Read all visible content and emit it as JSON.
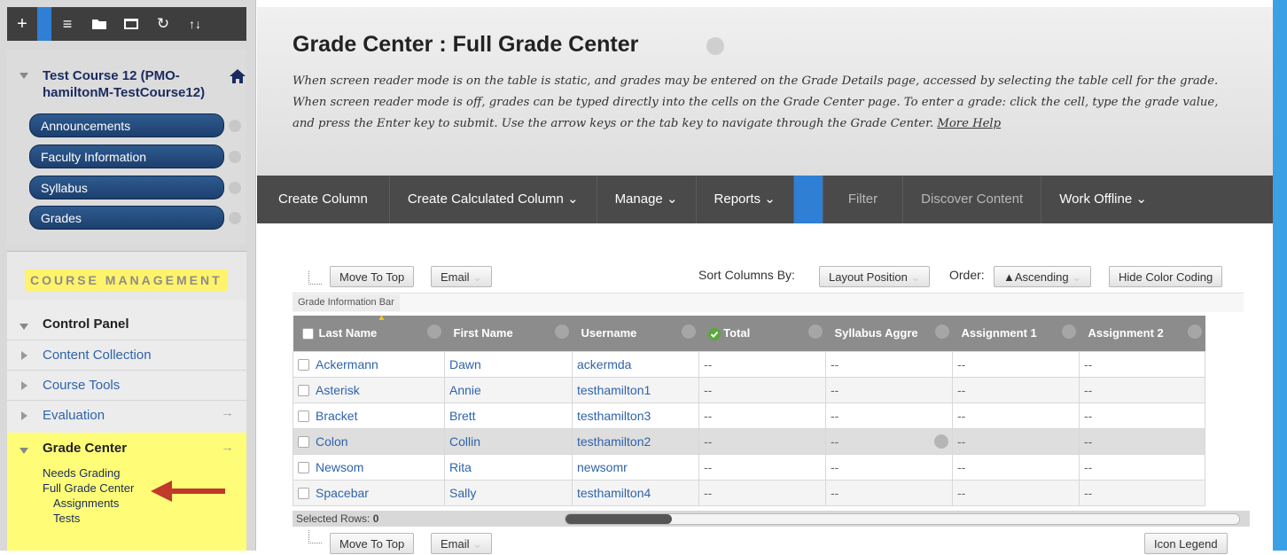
{
  "sidebar": {
    "toolbar": {
      "add_icon": "+",
      "list_icon": "≡",
      "folder_icon": "folder",
      "window_icon": "window",
      "refresh_icon": "↻",
      "sort_icon": "↑↓"
    },
    "course_title": "Test Course 12 (PMO-hamiltonM-TestCourse12)",
    "course_buttons": [
      "Announcements",
      "Faculty Information",
      "Syllabus",
      "Grades"
    ],
    "course_management_label": "COURSE MANAGEMENT",
    "control_panel": "Control Panel",
    "nav_items": [
      "Content Collection",
      "Course Tools",
      "Evaluation"
    ],
    "grade_center": "Grade Center",
    "grade_center_subitems": [
      "Needs Grading",
      "Full Grade Center"
    ],
    "full_grade_center_subitems": [
      "Assignments",
      "Tests"
    ],
    "arrow_glyph": "→"
  },
  "page": {
    "title": "Grade Center : Full Grade Center",
    "help_text": "When screen reader mode is on the table is static, and grades may be entered on the Grade Details page, accessed by selecting the table cell for the grade. When screen reader mode is off, grades can be typed directly into the cells on the Grade Center page. To enter a grade: click the cell, type the grade value, and press the Enter key to submit. Use the arrow keys or the tab key to navigate through the Grade Center.",
    "more_help": "More Help"
  },
  "action_bar": {
    "create_column": "Create Column",
    "create_calculated_column": "Create Calculated Column",
    "manage": "Manage",
    "reports": "Reports",
    "filter": "Filter",
    "discover_content": "Discover Content",
    "work_offline": "Work Offline"
  },
  "grid_controls": {
    "move_to_top": "Move To Top",
    "email": "Email",
    "sort_columns_by": "Sort Columns By:",
    "layout_position": "Layout Position",
    "order": "Order:",
    "ascending": "▲Ascending",
    "hide_color_coding": "Hide Color Coding",
    "grade_information_bar": "Grade Information Bar",
    "selected_rows_label": "Selected Rows:",
    "selected_rows_count": "0",
    "icon_legend": "Icon Legend"
  },
  "grid": {
    "columns": [
      "Last Name",
      "First Name",
      "Username",
      "Total",
      "Syllabus Aggre",
      "Assignment 1",
      "Assignment 2"
    ],
    "rows": [
      [
        "Ackermann",
        "Dawn",
        "ackermda",
        "--",
        "--",
        "--",
        "--"
      ],
      [
        "Asterisk",
        "Annie",
        "testhamilton1",
        "--",
        "--",
        "--",
        "--"
      ],
      [
        "Bracket",
        "Brett",
        "testhamilton3",
        "--",
        "--",
        "--",
        "--"
      ],
      [
        "Colon",
        "Collin",
        "testhamilton2",
        "--",
        "--",
        "--",
        "--"
      ],
      [
        "Newsom",
        "Rita",
        "newsomr",
        "--",
        "--",
        "--",
        "--"
      ],
      [
        "Spacebar",
        "Sally",
        "testhamilton4",
        "--",
        "--",
        "--",
        "--"
      ]
    ]
  },
  "colors": {
    "action_bar": "#4a4a4a",
    "accent_blue": "#2f7fd5",
    "highlight_yellow": "#fffd77",
    "annotation_arrow": "#c0392b"
  }
}
